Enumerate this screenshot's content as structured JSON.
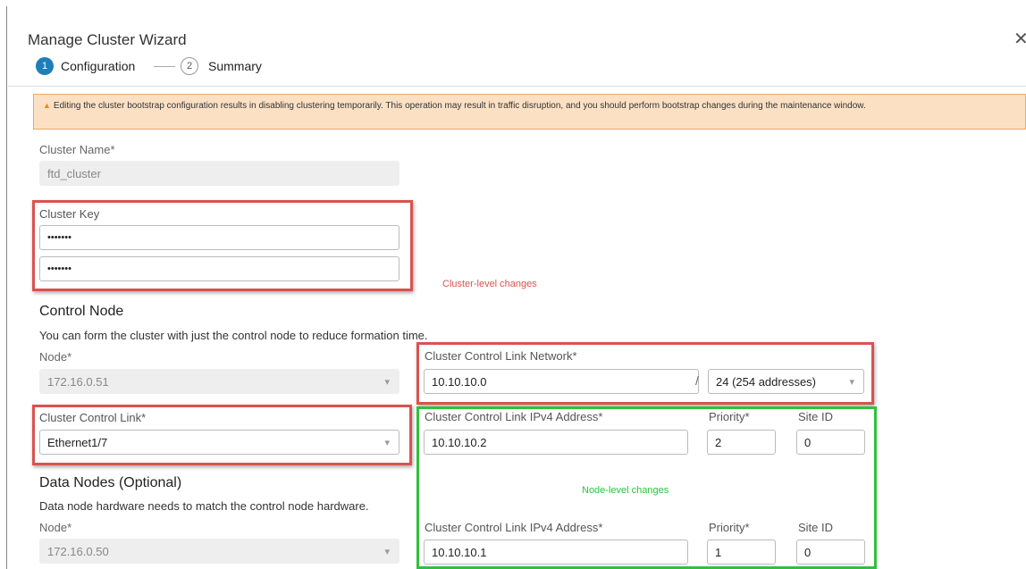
{
  "dialog": {
    "title": "Manage Cluster Wizard",
    "steps": [
      {
        "num": "1",
        "label": "Configuration"
      },
      {
        "num": "2",
        "label": "Summary"
      }
    ],
    "warning": "Editing the cluster bootstrap configuration results in disabling clustering temporarily. This operation may result in traffic disruption, and you should perform bootstrap changes during the maintenance window."
  },
  "cluster": {
    "name_label": "Cluster Name*",
    "name_value": "ftd_cluster",
    "key_label": "Cluster Key",
    "key_value": "•••••••",
    "key_confirm_value": "•••••••"
  },
  "annotations": {
    "cluster_level": "Cluster-level changes",
    "node_level": "Node-level changes"
  },
  "control_node": {
    "heading": "Control Node",
    "description": "You can form the cluster with just the control node to reduce formation time.",
    "node_label": "Node*",
    "node_value": "172.16.0.51",
    "ccl_label": "Cluster Control Link*",
    "ccl_value": "Ethernet1/7",
    "network_label": "Cluster Control Link Network*",
    "network_value": "10.10.10.0",
    "slash": "/",
    "prefix_value": "24 (254 addresses)",
    "ipv4_label": "Cluster Control Link IPv4 Address*",
    "ipv4_value": "10.10.10.2",
    "priority_label": "Priority*",
    "priority_value": "2",
    "siteid_label": "Site ID",
    "siteid_value": "0"
  },
  "data_nodes": {
    "heading": "Data Nodes (Optional)",
    "description": "Data node hardware needs to match the control node hardware.",
    "node_label": "Node*",
    "node_value": "172.16.0.50",
    "ipv4_label": "Cluster Control Link IPv4 Address*",
    "ipv4_value": "10.10.10.1",
    "priority_label": "Priority*",
    "priority_value": "1",
    "siteid_label": "Site ID",
    "siteid_value": "0"
  },
  "colors": {
    "accent": "#1e7fb7",
    "warning_bg": "#fbe0c4",
    "annotation_red": "#d9534f",
    "annotation_green": "#2fc13b"
  }
}
